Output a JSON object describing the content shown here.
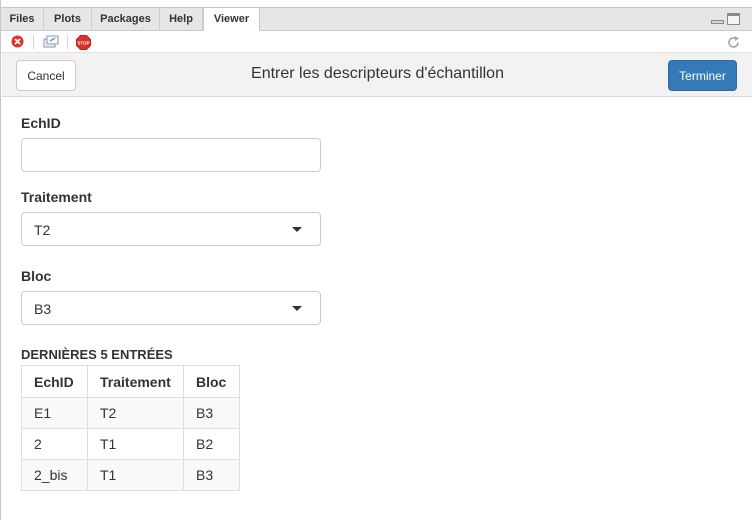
{
  "tabs": [
    {
      "label": "Files",
      "active": false
    },
    {
      "label": "Plots",
      "active": false
    },
    {
      "label": "Packages",
      "active": false
    },
    {
      "label": "Help",
      "active": false
    },
    {
      "label": "Viewer",
      "active": true
    }
  ],
  "toolbar": {
    "icons": [
      "clear-all-icon",
      "export-icon",
      "stop-icon",
      "refresh-icon"
    ],
    "stop_label": "STOP"
  },
  "gadget": {
    "title": "Entrer les descripteurs d'échantillon",
    "cancel_label": "Cancel",
    "done_label": "Terminer",
    "accent_color": "#337ab7"
  },
  "form": {
    "echid_label": "EchID",
    "echid_value": "",
    "traitement_label": "Traitement",
    "traitement_value": "T2",
    "bloc_label": "Bloc",
    "bloc_value": "B3"
  },
  "recent": {
    "title": "DERNIÈRES 5 ENTRÉES",
    "headers": [
      "EchID",
      "Traitement",
      "Bloc"
    ],
    "rows": [
      [
        "E1",
        "T2",
        "B3"
      ],
      [
        "2",
        "T1",
        "B2"
      ],
      [
        "2_bis",
        "T1",
        "B3"
      ]
    ]
  }
}
